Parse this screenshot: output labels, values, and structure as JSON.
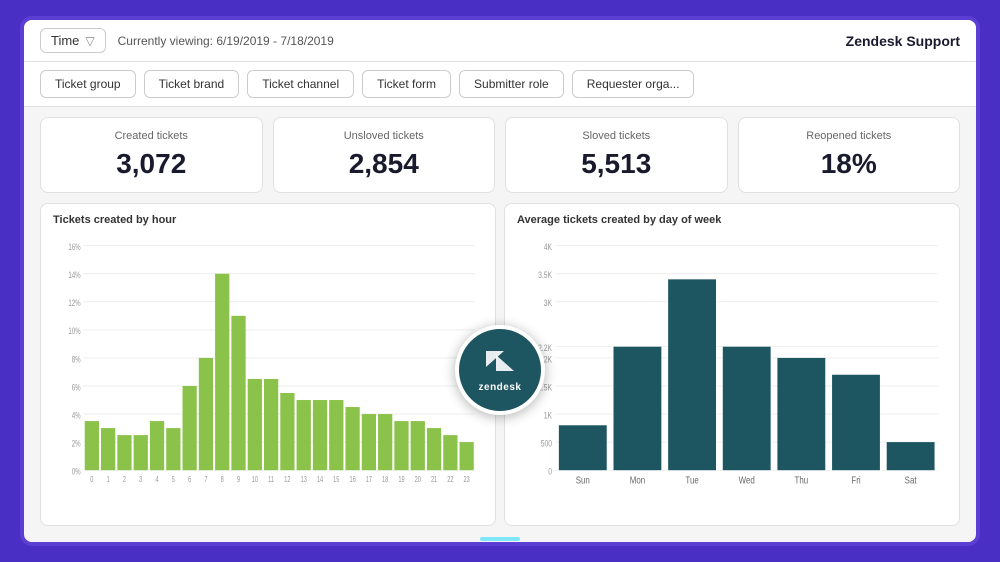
{
  "header": {
    "time_filter_label": "Time",
    "date_range": "Currently viewing: 6/19/2019 - 7/18/2019",
    "app_title": "Zendesk Support"
  },
  "pills": [
    {
      "label": "Ticket group"
    },
    {
      "label": "Ticket brand"
    },
    {
      "label": "Ticket channel"
    },
    {
      "label": "Ticket form"
    },
    {
      "label": "Submitter role"
    },
    {
      "label": "Requester orga..."
    }
  ],
  "metrics": [
    {
      "label": "Created tickets",
      "value": "3,072"
    },
    {
      "label": "Unsloved tickets",
      "value": "2,854"
    },
    {
      "label": "Sloved tickets",
      "value": "5,513"
    },
    {
      "label": "Reopened tickets",
      "value": "18%"
    }
  ],
  "chart_left": {
    "title": "Tickets created by hour",
    "x_labels": [
      "0",
      "1",
      "2",
      "3",
      "4",
      "5",
      "6",
      "7",
      "8",
      "9",
      "10",
      "11",
      "12",
      "13",
      "14",
      "15",
      "16",
      "17",
      "18",
      "19",
      "20",
      "21",
      "22",
      "23"
    ],
    "y_labels": [
      "0%",
      "2%",
      "4%",
      "6%",
      "8%",
      "10%",
      "12%",
      "14%",
      "16%"
    ],
    "bars": [
      3.5,
      3.0,
      2.5,
      2.5,
      3.5,
      3.0,
      6.0,
      8.0,
      14.0,
      11.0,
      6.5,
      6.5,
      5.5,
      5.0,
      5.0,
      5.0,
      4.5,
      4.0,
      4.0,
      3.5,
      3.5,
      3.0,
      2.5,
      2.0
    ]
  },
  "chart_right": {
    "title": "Average tickets created by day of week",
    "x_labels": [
      "Sun",
      "Mon",
      "Tue",
      "Wed",
      "Thu",
      "Fri",
      "Sat"
    ],
    "y_labels": [
      "0",
      "500",
      "1K",
      "1.5K",
      "2K",
      "2.2K",
      "3K",
      "3.5K",
      "4K"
    ],
    "bars": [
      800,
      2200,
      3400,
      2200,
      2000,
      1700,
      500
    ]
  },
  "zendesk": {
    "icon": "Z",
    "text": "zendesk"
  }
}
